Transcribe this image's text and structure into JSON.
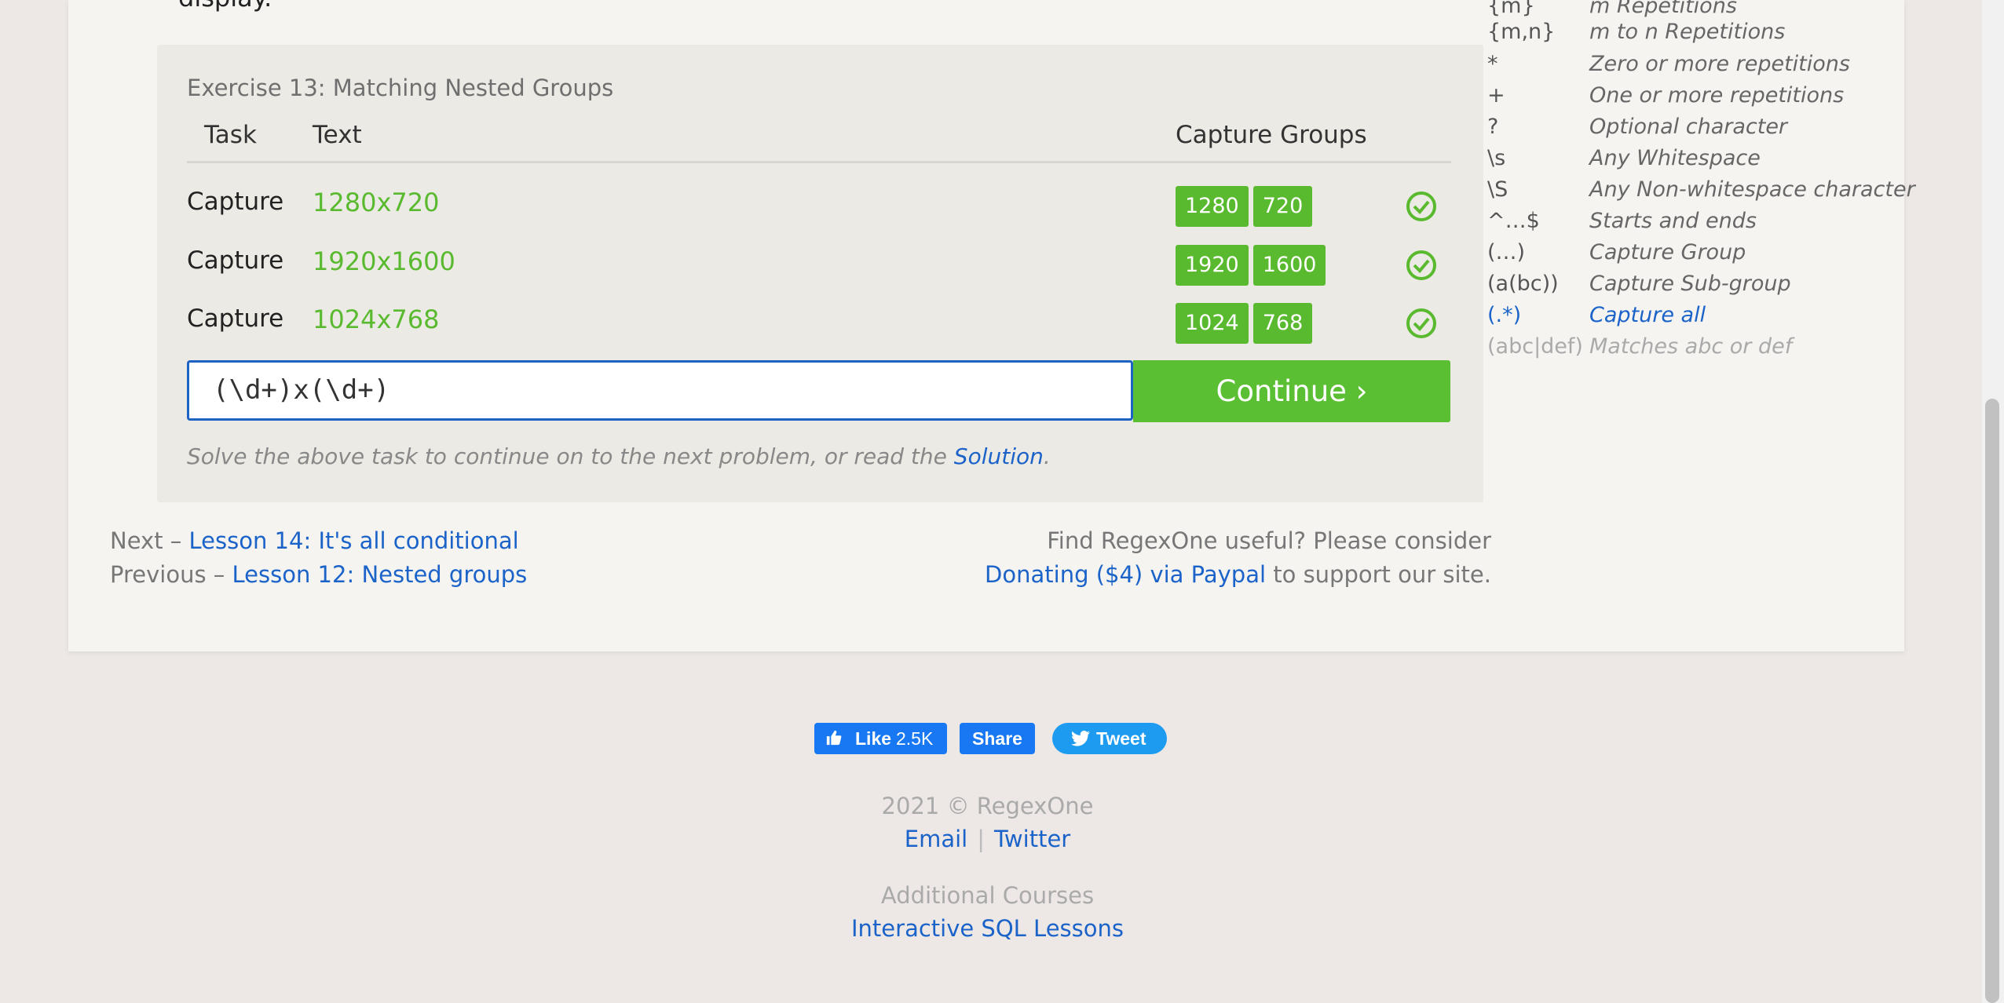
{
  "intro_tail": "display.",
  "exercise": {
    "title": "Exercise 13: Matching Nested Groups",
    "headers": {
      "task": "Task",
      "text": "Text",
      "capture": "Capture Groups"
    },
    "rows": [
      {
        "task": "Capture",
        "text": "1280x720",
        "groups": [
          "1280",
          "720"
        ]
      },
      {
        "task": "Capture",
        "text": "1920x1600",
        "groups": [
          "1920",
          "1600"
        ]
      },
      {
        "task": "Capture",
        "text": "1024x768",
        "groups": [
          "1024",
          "768"
        ]
      }
    ],
    "answer": "(\\d+)x(\\d+)",
    "continue_label": "Continue ›",
    "hint_prefix": "Solve the above task to continue on to the next problem, or read the ",
    "hint_link": "Solution",
    "hint_suffix": "."
  },
  "nav": {
    "next_prefix": "Next – ",
    "next_link": "Lesson 14: It's all conditional",
    "prev_prefix": "Previous – ",
    "prev_link": "Lesson 12: Nested groups",
    "donate_line1": "Find RegexOne useful? Please consider",
    "donate_link": "Donating ($4) via Paypal",
    "donate_suffix": " to support our site."
  },
  "reference": [
    {
      "k": "{m}",
      "v": "m Repetitions"
    },
    {
      "k": "{m,n}",
      "v": "m to n Repetitions"
    },
    {
      "k": "*",
      "v": "Zero or more repetitions"
    },
    {
      "k": "+",
      "v": "One or more repetitions"
    },
    {
      "k": "?",
      "v": "Optional character"
    },
    {
      "k": "\\s",
      "v": "Any Whitespace"
    },
    {
      "k": "\\S",
      "v": "Any Non-whitespace character"
    },
    {
      "k": "^…$",
      "v": "Starts and ends"
    },
    {
      "k": "(…)",
      "v": "Capture Group"
    },
    {
      "k": "(a(bc))",
      "v": "Capture Sub-group"
    },
    {
      "k": "(.*)",
      "v": "Capture all"
    },
    {
      "k": "(abc|def)",
      "v": "Matches abc or def"
    }
  ],
  "social": {
    "like": "Like",
    "like_count": "2.5K",
    "share": "Share",
    "tweet": "Tweet"
  },
  "footer": {
    "copyright": "2021 © RegexOne",
    "email": "Email",
    "separator": "|",
    "twitter": "Twitter",
    "additional": "Additional Courses",
    "sql": "Interactive SQL Lessons"
  },
  "colors": {
    "accent_green": "#5aba2f",
    "link_blue": "#1b63c9",
    "fb_blue": "#1877f2",
    "twitter_blue": "#1d9bf0"
  }
}
